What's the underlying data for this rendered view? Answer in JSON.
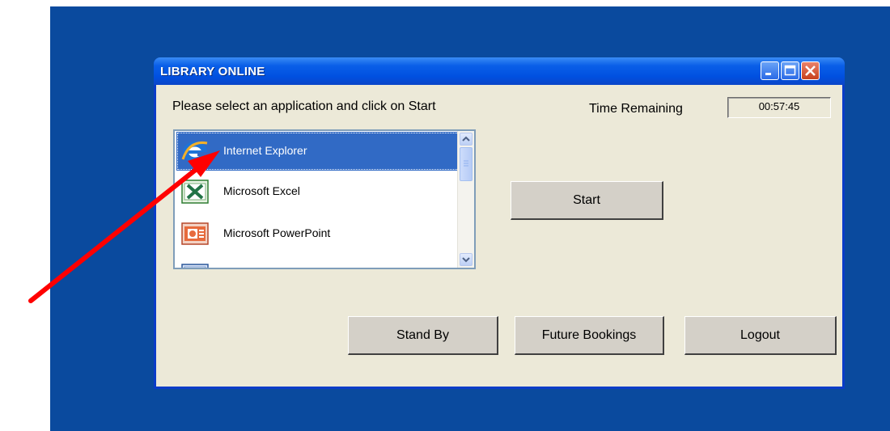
{
  "window": {
    "title": "LIBRARY ONLINE"
  },
  "main": {
    "prompt": "Please select an application and click on Start",
    "time_label": "Time Remaining",
    "time_value": "00:57:45"
  },
  "apps": [
    {
      "label": "Internet Explorer",
      "icon": "internet-explorer-icon",
      "selected": true
    },
    {
      "label": "Microsoft Excel",
      "icon": "excel-icon",
      "selected": false
    },
    {
      "label": "Microsoft PowerPoint",
      "icon": "powerpoint-icon",
      "selected": false
    },
    {
      "label": "",
      "icon": "word-icon",
      "selected": false
    }
  ],
  "buttons": {
    "start": "Start",
    "standby": "Stand By",
    "future": "Future Bookings",
    "logout": "Logout"
  },
  "colors": {
    "desktop": "#0a4a9e",
    "selection": "#316ac5",
    "annotation_arrow": "#ff0000"
  }
}
